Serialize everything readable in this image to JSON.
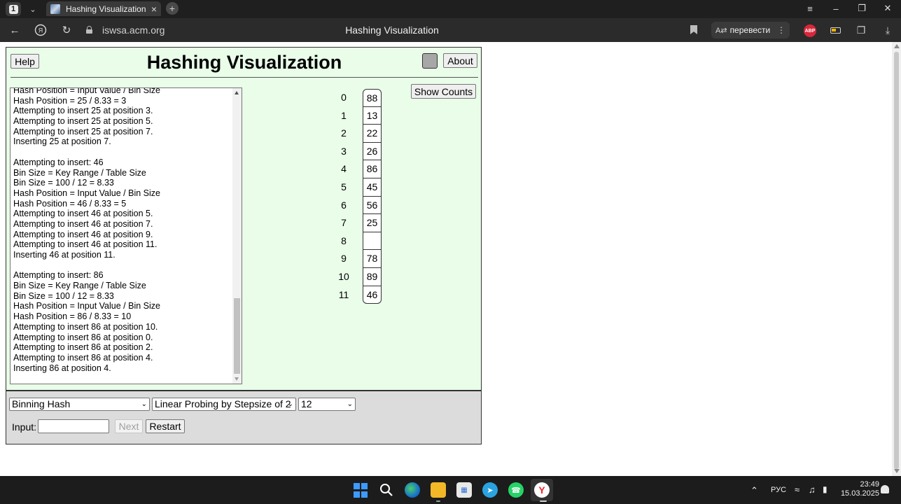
{
  "browser": {
    "tab_counter": "1",
    "tab_title": "Hashing Visualization",
    "url": "iswsa.acm.org",
    "page_title": "Hashing Visualization",
    "translate_label": "перевести",
    "abp_label": "ABP"
  },
  "app": {
    "help_label": "Help",
    "about_label": "About",
    "title": "Hashing Visualization",
    "show_counts_label": "Show Counts",
    "log_lines": [
      "Hash Position = Input Value / Bin Size",
      "Hash Position = 25 / 8.33 = 3",
      "Attempting to insert 25 at position 3.",
      "Attempting to insert 25 at position 5.",
      "Attempting to insert 25 at position 7.",
      "Inserting 25 at position 7.",
      "",
      "Attempting to insert: 46",
      "Bin Size = Key Range / Table Size",
      "Bin Size = 100 / 12 = 8.33",
      "Hash Position = Input Value / Bin Size",
      "Hash Position = 46 / 8.33 = 5",
      "Attempting to insert 46 at position 5.",
      "Attempting to insert 46 at position 7.",
      "Attempting to insert 46 at position 9.",
      "Attempting to insert 46 at position 11.",
      "Inserting 46 at position 11.",
      "",
      "Attempting to insert: 86",
      "Bin Size = Key Range / Table Size",
      "Bin Size = 100 / 12 = 8.33",
      "Hash Position = Input Value / Bin Size",
      "Hash Position = 86 / 8.33 = 10",
      "Attempting to insert 86 at position 10.",
      "Attempting to insert 86 at position 0.",
      "Attempting to insert 86 at position 2.",
      "Attempting to insert 86 at position 4.",
      "Inserting 86 at position 4."
    ],
    "table": [
      {
        "index": "0",
        "value": "88"
      },
      {
        "index": "1",
        "value": "13"
      },
      {
        "index": "2",
        "value": "22"
      },
      {
        "index": "3",
        "value": "26"
      },
      {
        "index": "4",
        "value": "86"
      },
      {
        "index": "5",
        "value": "45"
      },
      {
        "index": "6",
        "value": "56"
      },
      {
        "index": "7",
        "value": "25"
      },
      {
        "index": "8",
        "value": ""
      },
      {
        "index": "9",
        "value": "78"
      },
      {
        "index": "10",
        "value": "89"
      },
      {
        "index": "11",
        "value": "46"
      }
    ],
    "controls": {
      "hash_function": "Binning Hash",
      "collision_policy": "Linear Probing by Stepsize of 2",
      "table_size": "12",
      "input_label": "Input:",
      "input_value": "",
      "next_label": "Next",
      "restart_label": "Restart"
    }
  },
  "taskbar": {
    "language": "РУС",
    "time": "23:49",
    "date": "15.03.2025"
  },
  "colors": {
    "frame_bg": "#e9fde9",
    "panel_bg": "#dcdcdc",
    "color_square": "#a7a7a7",
    "browser_dark": "#1f1f1f"
  }
}
